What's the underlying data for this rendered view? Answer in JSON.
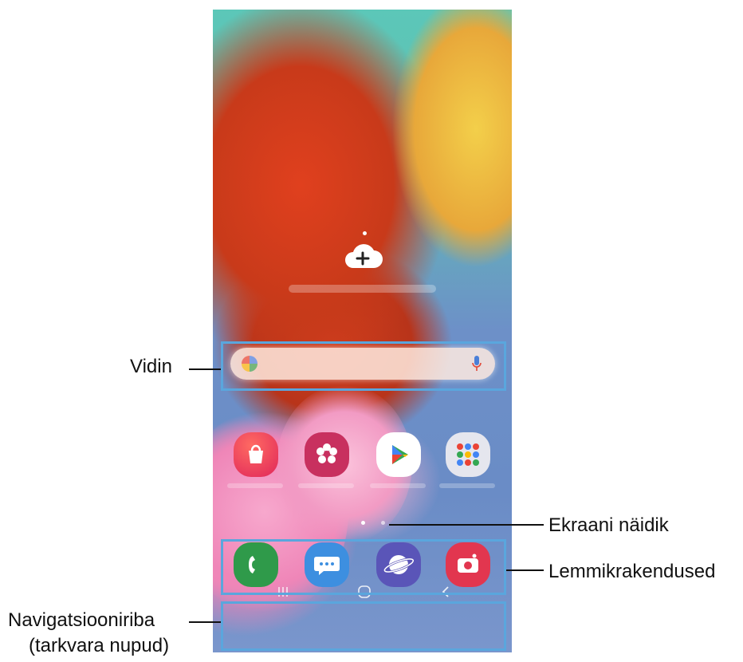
{
  "annotations": {
    "widget": "Vidin",
    "screen_indicator": "Ekraani näidik",
    "favorite_apps": "Lemmikrakendused",
    "navbar_line1": "Navigatsiooniriba",
    "navbar_line2": "(tarkvara nupud)"
  },
  "home_screen": {
    "apps": [
      {
        "name": "galaxy-store",
        "color": "#e8394a"
      },
      {
        "name": "gallery",
        "color": "#c83263"
      },
      {
        "name": "play-store",
        "color": "#ffffff"
      },
      {
        "name": "google-folder",
        "color": "#dcdde6"
      }
    ],
    "dock": [
      {
        "name": "phone",
        "color": "#2f9a4a"
      },
      {
        "name": "messages",
        "color": "#3c8ee0"
      },
      {
        "name": "internet",
        "color": "#5a55b8"
      },
      {
        "name": "camera",
        "color": "#e2364f"
      }
    ],
    "page_indicator": {
      "pages": 2,
      "current": 1
    }
  },
  "colors": {
    "accent_box": "#5aa6dd"
  }
}
